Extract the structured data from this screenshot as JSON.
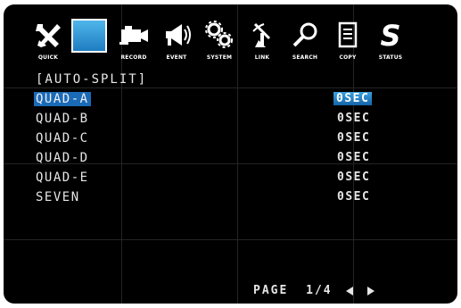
{
  "toolbar": {
    "items": [
      {
        "name": "quick",
        "label": "QUICK",
        "icon": "tools-icon"
      },
      {
        "name": "display",
        "label": "",
        "icon": "monitor-icon",
        "active": true
      },
      {
        "name": "record",
        "label": "RECORD",
        "icon": "camera-icon"
      },
      {
        "name": "event",
        "label": "EVENT",
        "icon": "megaphone-icon"
      },
      {
        "name": "system",
        "label": "SYSTEM",
        "icon": "gears-icon"
      },
      {
        "name": "link",
        "label": "LINK",
        "icon": "antenna-icon"
      },
      {
        "name": "search",
        "label": "SEARCH",
        "icon": "magnifier-icon"
      },
      {
        "name": "copy",
        "label": "COPY",
        "icon": "document-icon"
      },
      {
        "name": "status",
        "label": "STATUS",
        "icon": "s-letter-icon"
      }
    ]
  },
  "section": {
    "title": "[AUTO-SPLIT]"
  },
  "rows": [
    {
      "name": "QUAD-A",
      "value": "0SEC",
      "selected": true
    },
    {
      "name": "QUAD-B",
      "value": "0SEC"
    },
    {
      "name": "QUAD-C",
      "value": "0SEC"
    },
    {
      "name": "QUAD-D",
      "value": "0SEC"
    },
    {
      "name": "QUAD-E",
      "value": "0SEC"
    },
    {
      "name": "SEVEN",
      "value": "0SEC"
    }
  ],
  "footer": {
    "page_label": "PAGE",
    "page_value": "1/4"
  },
  "colors": {
    "background": "#000000",
    "text": "#e6e6e6",
    "highlight": "#1a6ab8",
    "icon": "#ffffff",
    "active_icon": "#2f95d6"
  }
}
